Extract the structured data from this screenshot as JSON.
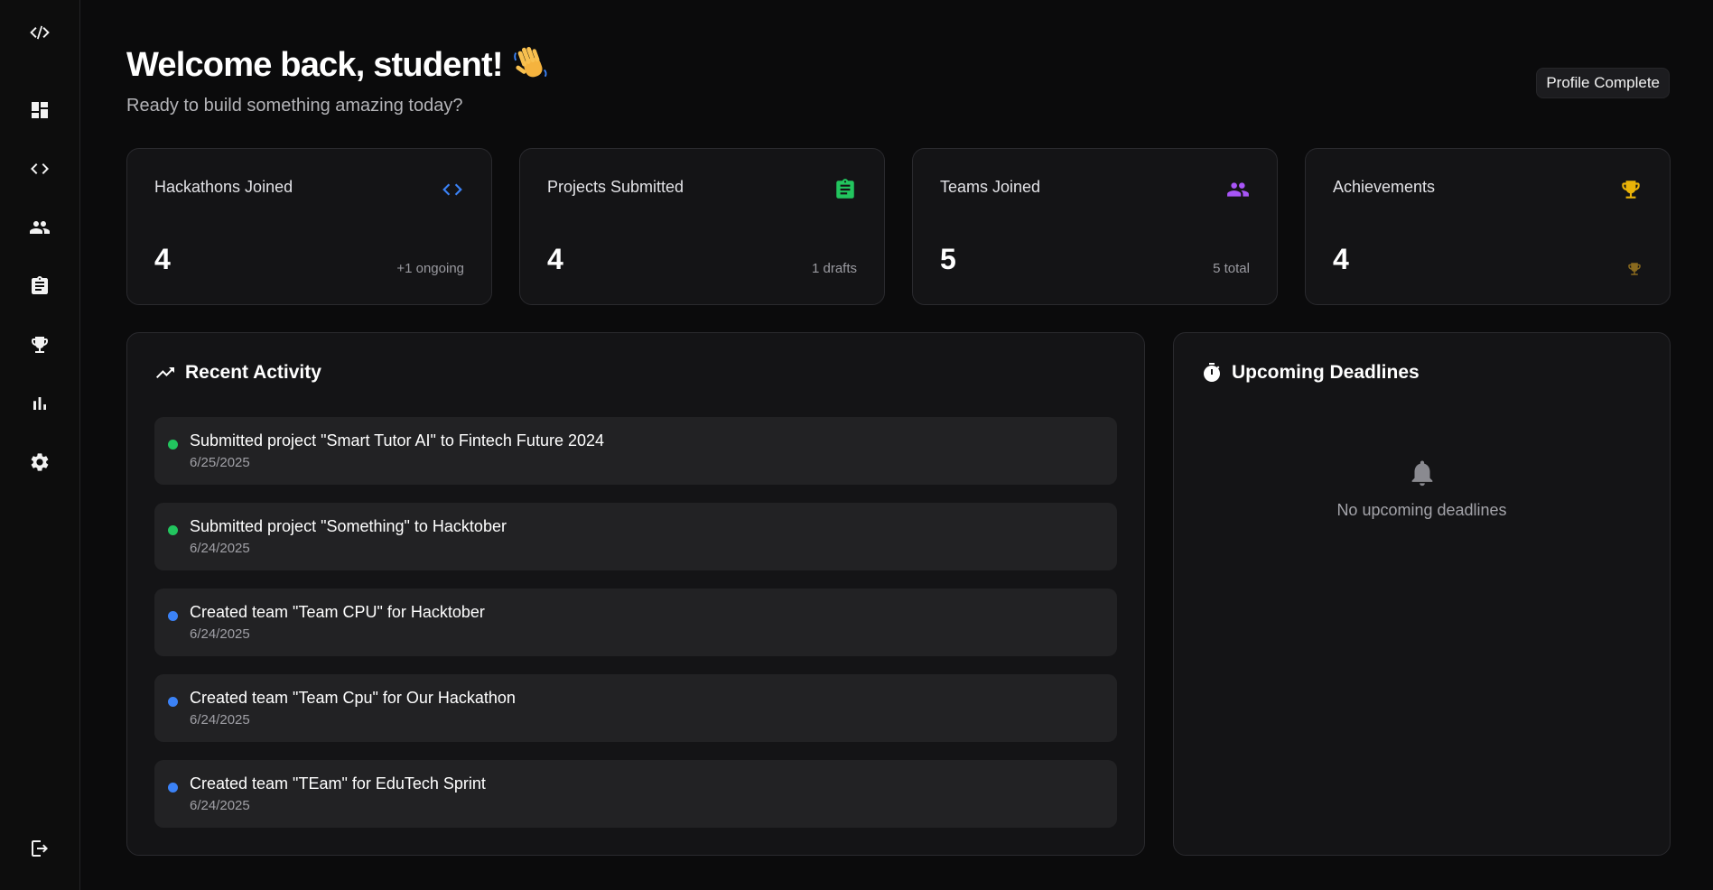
{
  "sidebar": {
    "icons": [
      "code-logo-icon",
      "dashboard-icon",
      "code-icon",
      "people-icon",
      "clipboard-icon",
      "trophy-icon",
      "bar-chart-icon",
      "gear-icon",
      "logout-icon"
    ]
  },
  "header": {
    "title": "Welcome back, student!",
    "subtitle": "Ready to build something amazing today?",
    "badge": "Profile Complete"
  },
  "stats": [
    {
      "label": "Hackathons Joined",
      "value": "4",
      "sub": "+1 ongoing",
      "icon": "code-icon",
      "color": "#3b82f6"
    },
    {
      "label": "Projects Submitted",
      "value": "4",
      "sub": "1 drafts",
      "icon": "clipboard-icon",
      "color": "#22c55e"
    },
    {
      "label": "Teams Joined",
      "value": "5",
      "sub": "5 total",
      "icon": "people-icon",
      "color": "#a855f7"
    },
    {
      "label": "Achievements",
      "value": "4",
      "sub": "",
      "icon": "trophy-icon",
      "color": "#eab308"
    }
  ],
  "activity": {
    "title": "Recent Activity",
    "items": [
      {
        "text": "Submitted project \"Smart Tutor AI\" to Fintech Future 2024",
        "date": "6/25/2025",
        "color": "#22c55e"
      },
      {
        "text": "Submitted project \"Something\" to Hacktober",
        "date": "6/24/2025",
        "color": "#22c55e"
      },
      {
        "text": "Created team \"Team CPU\" for Hacktober",
        "date": "6/24/2025",
        "color": "#3b82f6"
      },
      {
        "text": "Created team \"Team Cpu\" for Our Hackathon",
        "date": "6/24/2025",
        "color": "#3b82f6"
      },
      {
        "text": "Created team \"TEam\" for EduTech Sprint",
        "date": "6/24/2025",
        "color": "#3b82f6"
      }
    ]
  },
  "deadlines": {
    "title": "Upcoming Deadlines",
    "empty_text": "No upcoming deadlines"
  }
}
